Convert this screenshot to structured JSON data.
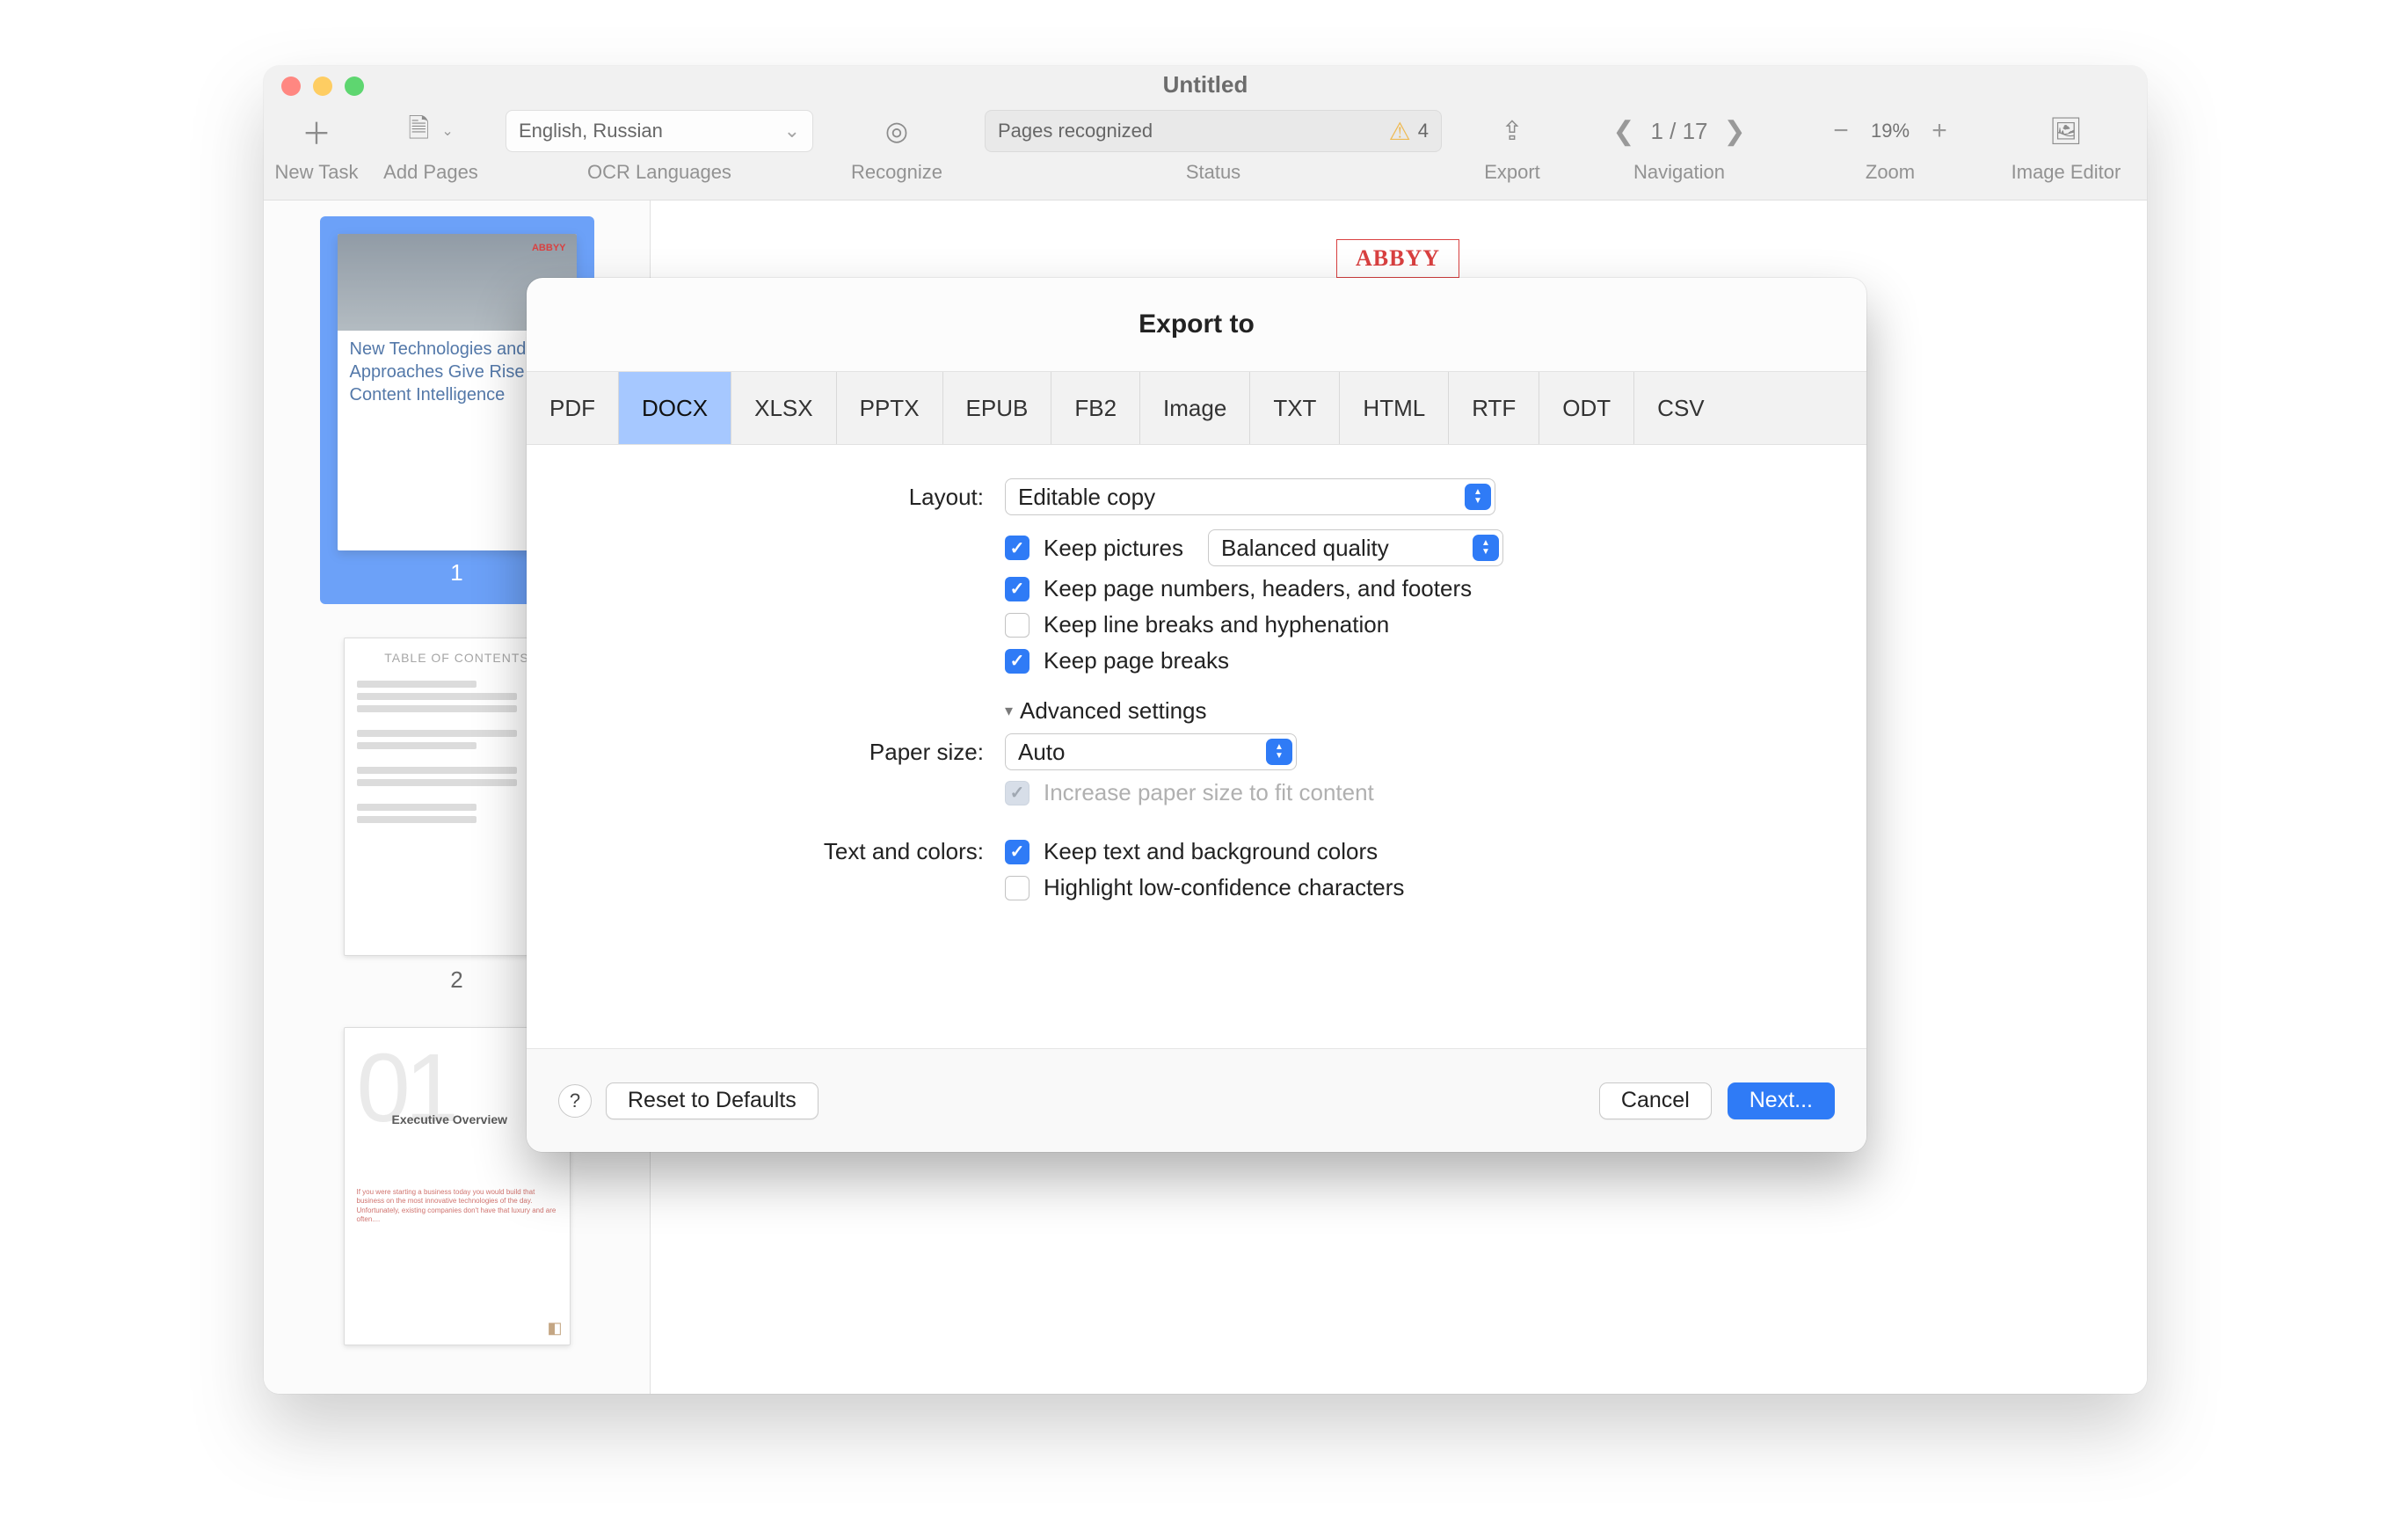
{
  "window": {
    "title": "Untitled"
  },
  "toolbar": {
    "new_task": "New Task",
    "add_pages": "Add Pages",
    "ocr_languages": "OCR Languages",
    "lang_value": "English, Russian",
    "recognize": "Recognize",
    "status": "Status",
    "status_text": "Pages recognized",
    "status_warn_count": "4",
    "export": "Export",
    "navigation": "Navigation",
    "page_indicator": "1 / 17",
    "zoom": "Zoom",
    "zoom_value": "19%",
    "image_editor": "Image Editor"
  },
  "thumbs": {
    "page1": {
      "num": "1",
      "logo": "ABBYY",
      "headline": "New Technologies and Approaches Give Rise to Content Intelligence"
    },
    "page2": {
      "num": "2",
      "toc": "TABLE OF CONTENTS"
    },
    "page3": {
      "num": "01",
      "title": "Executive Overview"
    }
  },
  "canvas": {
    "logo": "ABBYY"
  },
  "modal": {
    "title": "Export to",
    "tabs": [
      "PDF",
      "DOCX",
      "XLSX",
      "PPTX",
      "EPUB",
      "FB2",
      "Image",
      "TXT",
      "HTML",
      "RTF",
      "ODT",
      "CSV"
    ],
    "active_tab": "DOCX",
    "labels": {
      "layout": "Layout:",
      "paper_size": "Paper size:",
      "text_colors": "Text and colors:"
    },
    "selects": {
      "layout_value": "Editable copy",
      "pictures_value": "Balanced quality",
      "paper_value": "Auto"
    },
    "checks": {
      "keep_pictures": "Keep pictures",
      "keep_headers": "Keep page numbers, headers, and footers",
      "keep_linebreaks": "Keep line breaks and hyphenation",
      "keep_pagebreaks": "Keep page breaks",
      "advanced": "Advanced settings",
      "increase_paper": "Increase paper size to fit content",
      "keep_text_colors": "Keep text and background colors",
      "highlight_low": "Highlight low-confidence characters"
    },
    "buttons": {
      "help": "?",
      "reset": "Reset to Defaults",
      "cancel": "Cancel",
      "next": "Next..."
    }
  }
}
